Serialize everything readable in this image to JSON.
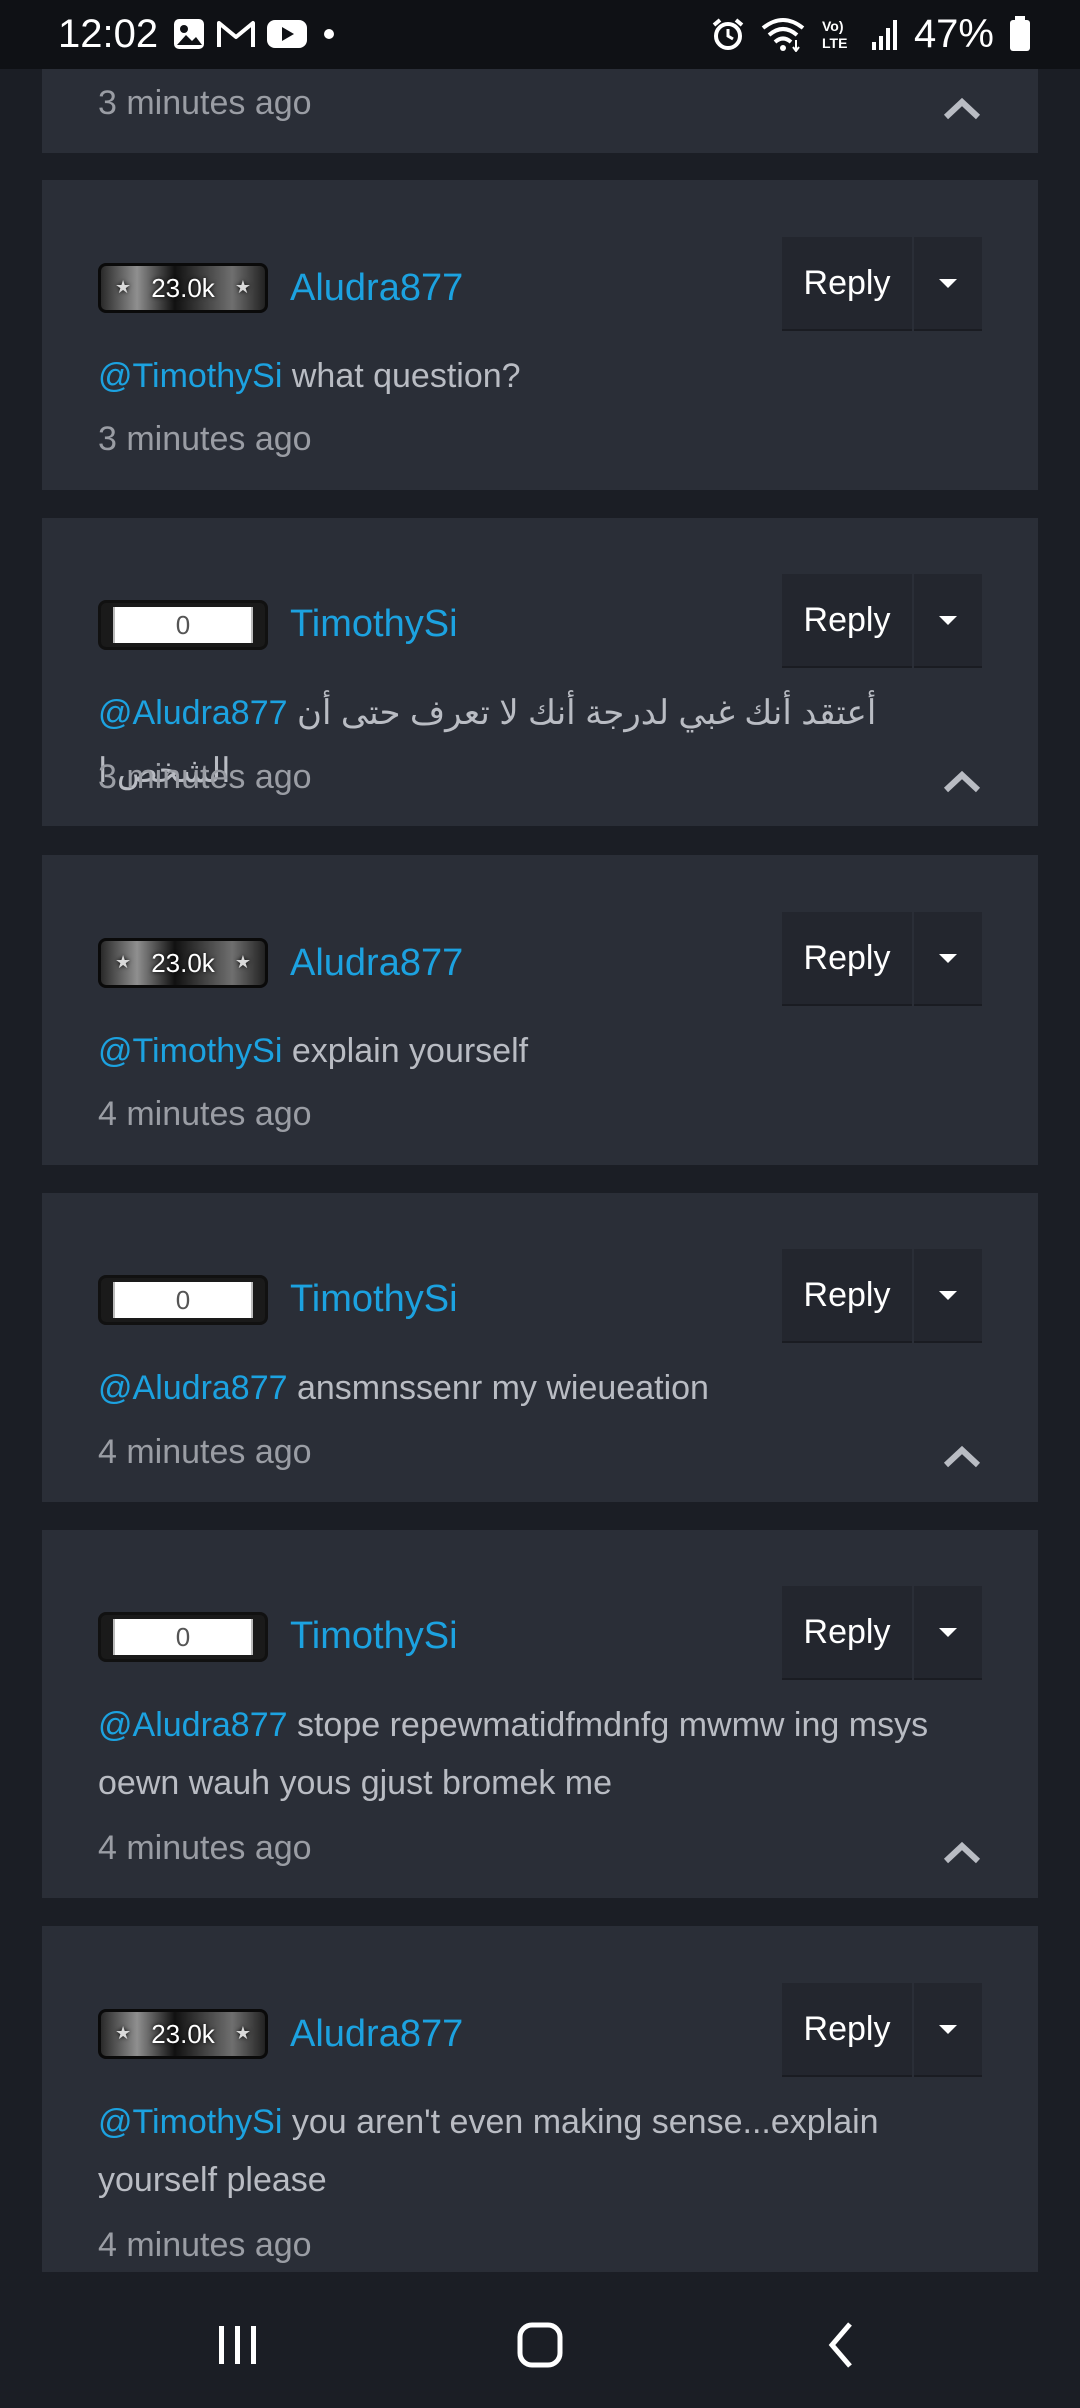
{
  "status_bar": {
    "time": "12:02",
    "battery": "47%",
    "icons": [
      "gallery-icon",
      "gmail-icon",
      "youtube-icon",
      "dot-icon",
      "alarm-icon",
      "wifi-icon",
      "volte-icon",
      "signal-icon",
      "battery-icon"
    ]
  },
  "top_partial": {
    "timestamp": "3 minutes ago"
  },
  "comments": [
    {
      "badge": "23.0k",
      "badge_style": "dark",
      "username": "Aludra877",
      "reply_label": "Reply",
      "mention": "@TimothySi",
      "text": " what question?",
      "timestamp": "3 minutes ago",
      "collapse": false
    },
    {
      "badge": "0",
      "badge_style": "light",
      "username": "TimothySi",
      "reply_label": "Reply",
      "mention": "@Aludra877",
      "text": " أعتقد أنك غبي لدرجة أنك لا تعرف حتى أن الشخص ا",
      "timestamp": "3 minutes ago",
      "collapse": true
    },
    {
      "badge": "23.0k",
      "badge_style": "dark",
      "username": "Aludra877",
      "reply_label": "Reply",
      "mention": "@TimothySi",
      "text": " explain yourself",
      "timestamp": "4 minutes ago",
      "collapse": false
    },
    {
      "badge": "0",
      "badge_style": "light",
      "username": "TimothySi",
      "reply_label": "Reply",
      "mention": "@Aludra877",
      "text": " ansmnssenr my wieueation",
      "timestamp": "4 minutes ago",
      "collapse": true
    },
    {
      "badge": "0",
      "badge_style": "light",
      "username": "TimothySi",
      "reply_label": "Reply",
      "mention": "@Aludra877",
      "text": " stope repewmatidfmdnfg mwmw ing msys oewn wauh yous gjust bromek me",
      "timestamp": "4 minutes ago",
      "collapse": true
    },
    {
      "badge": "23.0k",
      "badge_style": "dark",
      "username": "Aludra877",
      "reply_label": "Reply",
      "mention": "@TimothySi",
      "text": " you aren't even making sense...explain yourself please",
      "timestamp": "4 minutes ago",
      "collapse": false
    }
  ],
  "nav_bar": {
    "buttons": [
      "recent-apps",
      "home",
      "back"
    ]
  }
}
